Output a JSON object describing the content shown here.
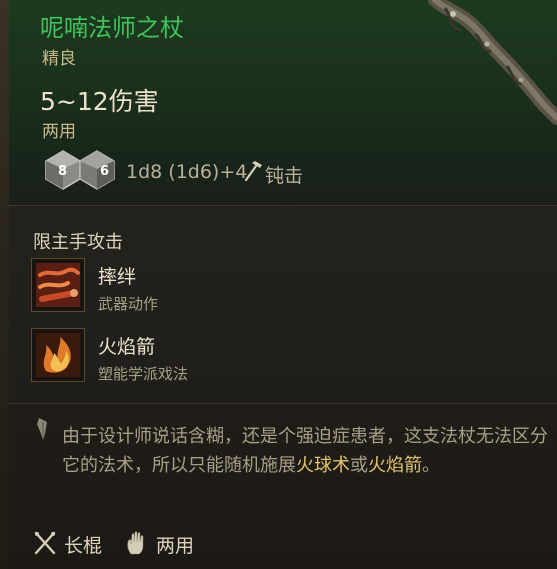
{
  "item": {
    "name": "呢喃法师之杖",
    "rarity": "精良",
    "damage_range": "5~12伤害",
    "handedness": "两用"
  },
  "damage_roll": {
    "die_primary": "8",
    "die_secondary": "6",
    "formula": "1d8 (1d6)+4",
    "type": "钝击",
    "type_icon": "hammer-icon"
  },
  "actions_section": {
    "title": "限主手攻击",
    "actions": [
      {
        "name": "摔绊",
        "category": "武器动作",
        "icon": "topple-icon"
      },
      {
        "name": "火焰箭",
        "category": "塑能学派戏法",
        "icon": "fire-bolt-icon"
      }
    ]
  },
  "flavor": {
    "icon": "quill-icon",
    "part1": "由于设计师说话含糊，还是个强迫症患者，这支法杖无法区分它的法术，所以只能随机施展",
    "highlight1": "火球术",
    "connector": "或",
    "highlight2": "火焰箭",
    "part2": "。"
  },
  "properties": [
    {
      "label": "长棍",
      "icon": "quarterstaff-icon"
    },
    {
      "label": "两用",
      "icon": "hand-icon"
    }
  ],
  "colors": {
    "name": "#3fc25a",
    "highlight": "#e2c36b",
    "header_bg": "#1d3a1e"
  }
}
